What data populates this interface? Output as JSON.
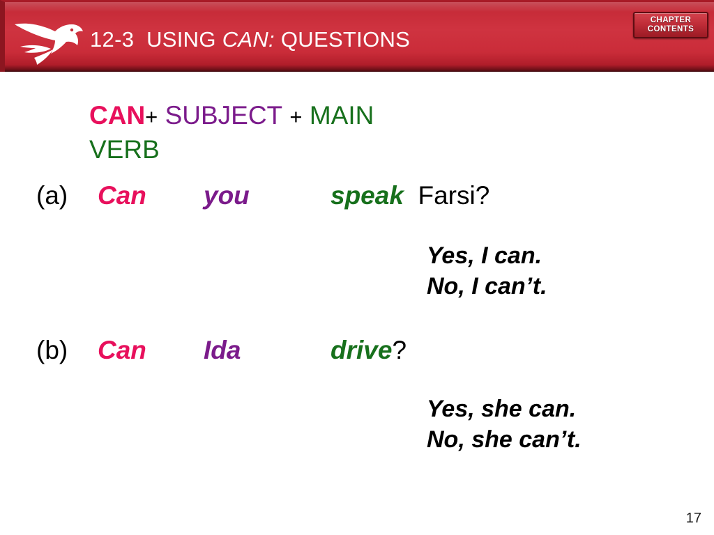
{
  "header": {
    "logo_icon": "swallow-bird-icon",
    "unit_number": "12-3",
    "title_pre": "USING",
    "title_italic": "CAN:",
    "title_post": "QUESTIONS",
    "chapter_button_line1": "CHAPTER",
    "chapter_button_line2": "CONTENTS",
    "banner_color": "#c62b38",
    "banner_edge_color": "#3b070c"
  },
  "formula": {
    "modal": "CAN",
    "plus1": "+",
    "subject": "SUBJECT",
    "plus2": "+",
    "main_verb": "MAIN VERB",
    "modal_color": "#e8105c",
    "subject_color": "#7b1b8b",
    "verb_color": "#17701c"
  },
  "examples": [
    {
      "label": "(a)",
      "modal": "Can",
      "subject": "you",
      "verb": "speak",
      "rest": "Farsi?",
      "answers": [
        "Yes, I can.",
        "No, I can’t."
      ]
    },
    {
      "label": "(b)",
      "modal": "Can",
      "subject": "Ida",
      "verb": "drive",
      "rest": "?",
      "answers": [
        "Yes, she can.",
        "No, she can’t."
      ]
    }
  ],
  "footer": {
    "page_number": "17"
  }
}
